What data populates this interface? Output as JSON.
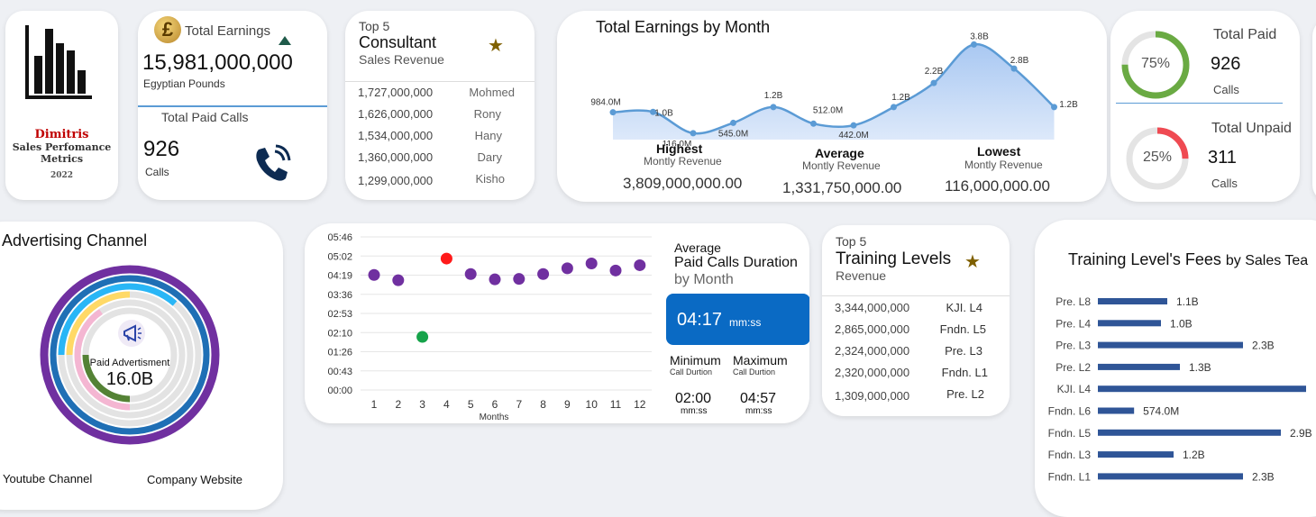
{
  "logo": {
    "name": "Dimitris",
    "line1": "Sales Perfomance",
    "line2": "Metrics",
    "year": "2022"
  },
  "earnings": {
    "title": "Total Earnings",
    "value": "15,981,000,000",
    "unit": "Egyptian Pounds",
    "paid_calls_title": "Total Paid Calls",
    "paid_calls_value": "926",
    "paid_calls_unit": "Calls"
  },
  "consultants": {
    "top": "Top 5",
    "title": "Consultant",
    "subtitle": "Sales Revenue",
    "rows": [
      {
        "value": "1,727,000,000",
        "name": "Mohmed"
      },
      {
        "value": "1,626,000,000",
        "name": "Rony"
      },
      {
        "value": "1,534,000,000",
        "name": "Hany"
      },
      {
        "value": "1,360,000,000",
        "name": "Dary"
      },
      {
        "value": "1,299,000,000",
        "name": "Kisho"
      }
    ]
  },
  "monthly": {
    "title": "Total Earnings by Month",
    "labels": [
      "984.0M",
      "1.0B",
      "116.0M",
      "545.0M",
      "1.2B",
      "512.0M",
      "442.0M",
      "1.2B",
      "2.2B",
      "3.8B",
      "2.8B",
      "1.2B"
    ],
    "highest_label": "Highest",
    "highest_sub": "Montly Revenue",
    "highest_value": "3,809,000,000.00",
    "average_label": "Average",
    "average_sub": "Montly Revenue",
    "average_value": "1,331,750,000.00",
    "lowest_label": "Lowest",
    "lowest_sub": "Montly Revenue",
    "lowest_value": "116,000,000.00"
  },
  "calls": {
    "paid_title": "Total Paid",
    "paid_value": "926",
    "paid_unit": "Calls",
    "paid_pct": "75%",
    "unpaid_title": "Total Unpaid",
    "unpaid_value": "311",
    "unpaid_unit": "Calls",
    "unpaid_pct": "25%",
    "paid_color": "#6aaa43",
    "unpaid_color": "#ef4a52"
  },
  "advertising": {
    "title": "Advertising Channel",
    "center_label": "Paid Advertisment",
    "center_value": "16.0B",
    "legend_left": "Youtube Channel",
    "legend_right": "Company Website"
  },
  "duration": {
    "title_line1": "Average",
    "title_line2": "Paid Calls Duration",
    "title_line3": "by Month",
    "avg_value": "04:17",
    "avg_unit": "mm:ss",
    "min_label": "Minimum",
    "min_sub": "Call Durtion",
    "min_value": "02:00",
    "min_unit": "mm:ss",
    "max_label": "Maximum",
    "max_sub": "Call Durtion",
    "max_value": "04:57",
    "max_unit": "mm:ss",
    "xlabel": "Months"
  },
  "training": {
    "top": "Top 5",
    "title": "Training Levels",
    "subtitle": "Revenue",
    "rows": [
      {
        "value": "3,344,000,000",
        "name": "KJI. L4"
      },
      {
        "value": "2,865,000,000",
        "name": "Fndn. L5"
      },
      {
        "value": "2,324,000,000",
        "name": "Pre. L3"
      },
      {
        "value": "2,320,000,000",
        "name": "Fndn. L1"
      },
      {
        "value": "1,309,000,000",
        "name": "Pre. L2"
      }
    ]
  },
  "fees": {
    "title": "Training Level's Fees",
    "title_suffix": "by Sales Tea"
  },
  "chart_data": [
    {
      "type": "area",
      "title": "Total Earnings by Month",
      "x": [
        1,
        2,
        3,
        4,
        5,
        6,
        7,
        8,
        9,
        10,
        11,
        12
      ],
      "values": [
        984,
        1000,
        116,
        545,
        1200,
        512,
        442,
        1200,
        2200,
        3800,
        2800,
        1200
      ],
      "unit": "millions"
    },
    {
      "type": "scatter",
      "xlabel": "Months",
      "x": [
        1,
        2,
        3,
        4,
        5,
        6,
        7,
        8,
        9,
        10,
        11,
        12
      ],
      "values_seconds": [
        260,
        248,
        120,
        297,
        262,
        250,
        251,
        262,
        275,
        286,
        270,
        282
      ],
      "y_ticks": [
        "00:00",
        "00:43",
        "01:26",
        "02:10",
        "02:53",
        "03:36",
        "04:19",
        "05:02",
        "05:46"
      ],
      "highlight_max_color": "#ff1a1a",
      "highlight_min_color": "#16a34a",
      "point_color": "#7030a0"
    },
    {
      "type": "bar",
      "orientation": "horizontal",
      "categories": [
        "Pre. L8",
        "Pre. L4",
        "Pre. L3",
        "Pre. L2",
        "KJI. L4",
        "Fndn. L6",
        "Fndn. L5",
        "Fndn. L3",
        "Fndn. L1"
      ],
      "values": [
        1.1,
        1.0,
        2.3,
        1.3,
        3.3,
        0.574,
        2.9,
        1.2,
        2.3
      ],
      "labels": [
        "1.1B",
        "1.0B",
        "2.3B",
        "1.3B",
        "",
        "574.0M",
        "2.9B",
        "1.2B",
        "2.3B"
      ],
      "color": "#2f5597"
    },
    {
      "type": "pie",
      "title": "Paid Calls",
      "values": [
        75,
        25
      ],
      "labels": [
        "75%",
        "25%"
      ]
    }
  ]
}
